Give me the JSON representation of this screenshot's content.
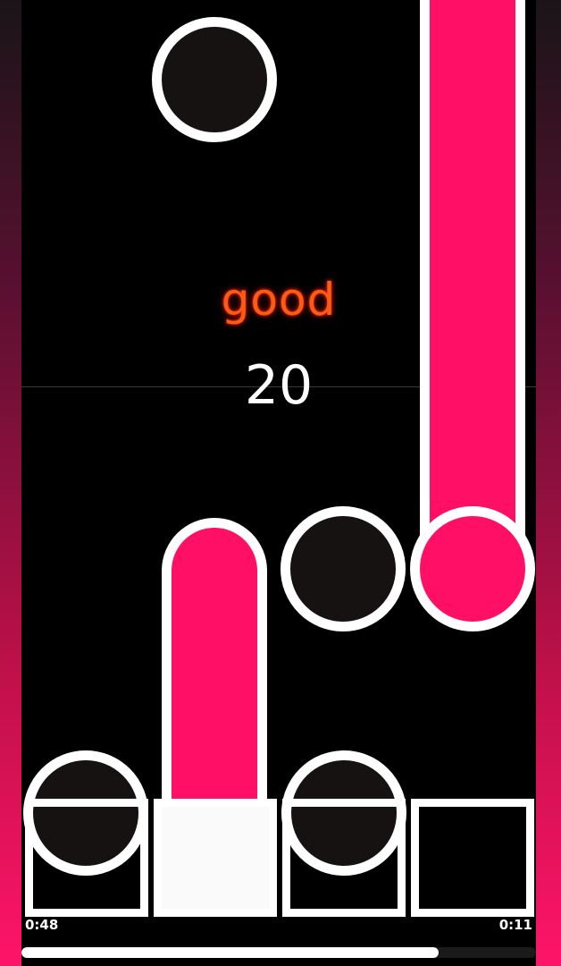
{
  "hud": {
    "judgement": "good",
    "combo": "20",
    "elapsed": "0:48",
    "remaining": "0:11",
    "progress_fraction": 0.81
  },
  "lanes": [
    {
      "name": "lane-1",
      "key_pressed": false
    },
    {
      "name": "lane-2",
      "key_pressed": true
    },
    {
      "name": "lane-3",
      "key_pressed": false
    },
    {
      "name": "lane-4",
      "key_pressed": false
    }
  ],
  "colors": {
    "accent": "#ff1066",
    "judgement": "#ff5a14",
    "background": "#000000",
    "note_fill": "#161212",
    "outline": "#ffffff"
  }
}
